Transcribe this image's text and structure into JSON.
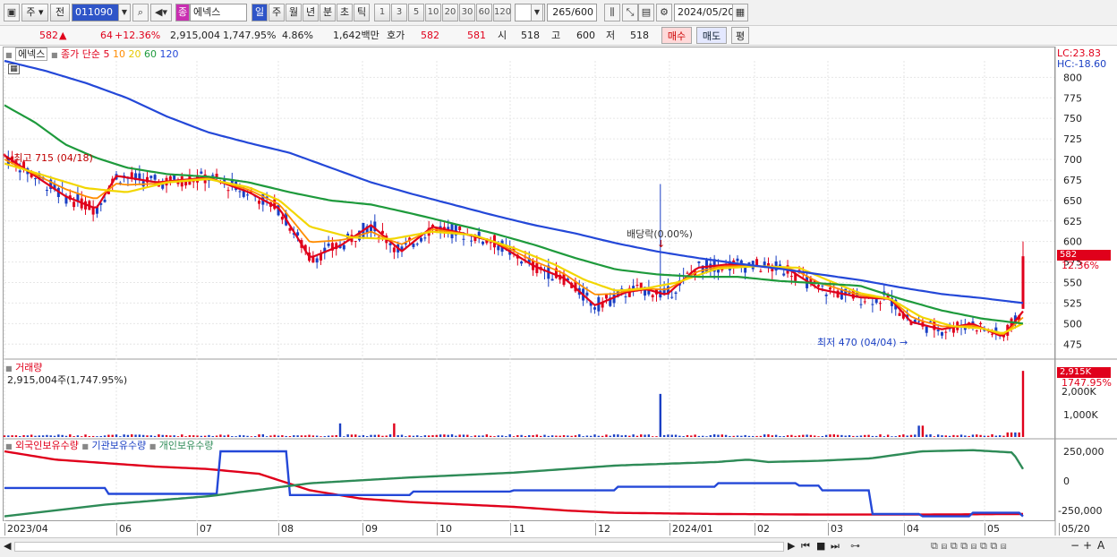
{
  "toolbar": {
    "type_label": "주",
    "prev_label": "전",
    "code_value": "011090",
    "company_value": "에넥스",
    "periods": [
      "일",
      "주",
      "월",
      "년",
      "분",
      "초",
      "틱"
    ],
    "minutes": [
      "1",
      "3",
      "5",
      "10",
      "20",
      "30",
      "60",
      "120"
    ],
    "count_value": "265",
    "count_total": "/600",
    "date_value": "2024/05/20"
  },
  "quote": {
    "price": "582",
    "change": "64",
    "change_pct": "+12.36%",
    "volume": "2,915,004",
    "volume_pct": "1,747.95%",
    "turnover": "4.86%",
    "amount": "1,642백만",
    "ask_label": "호가",
    "ask1": "582",
    "ask2": "581",
    "open_label": "시",
    "open": "518",
    "high_label": "고",
    "high": "600",
    "low_label": "저",
    "low": "518",
    "buy_label": "매수",
    "sell_label": "매도",
    "eval_label": "평"
  },
  "price_panel": {
    "legend_name": "에넥스",
    "legend_ma": "종가 단순",
    "ma_periods": [
      "5",
      "10",
      "20",
      "60",
      "120"
    ],
    "lc": "LC:23.83",
    "hc": "HC:-18.60",
    "high_note": "최고 715 (04/18)",
    "low_note": "최저 470 (04/04)",
    "dividend_note": "배당락(0.00%)",
    "current_price_tag": "582",
    "current_pct_tag": "12.36%",
    "y_ticks": [
      "800",
      "775",
      "750",
      "725",
      "700",
      "675",
      "650",
      "625",
      "600",
      "575",
      "550",
      "525",
      "500",
      "475"
    ]
  },
  "volume_panel": {
    "title": "거래량",
    "value_text": "2,915,004주(1,747.95%)",
    "current_tag": "2,915K",
    "current_pct": "1747.95%",
    "y_ticks": [
      "2,000K",
      "1,000K"
    ]
  },
  "holding_panel": {
    "legend": [
      "외국인보유수량",
      "기관보유수량",
      "개인보유수량"
    ],
    "y_ticks": [
      "250,000",
      "0",
      "-250,000"
    ]
  },
  "x_axis": [
    "2023/04",
    "06",
    "07",
    "08",
    "09",
    "10",
    "11",
    "12",
    "2024/01",
    "02",
    "03",
    "04",
    "05",
    "05/20"
  ],
  "colors": {
    "up": "#e0001b",
    "down": "#1a3fc4",
    "ma5": "#e0001b",
    "ma10": "#ff8c00",
    "ma20": "#f2d600",
    "ma60": "#1e9a3c",
    "ma120": "#2448d8",
    "foreign": "#e0001b",
    "inst": "#2448d8",
    "indiv": "#2e8b57"
  },
  "chart_data": {
    "type": "candlestick",
    "title": "에넥스",
    "period": "daily",
    "last": {
      "date": "2024/05/20",
      "open": 518,
      "high": 600,
      "low": 518,
      "close": 582,
      "volume": 2915004
    },
    "price_range": [
      460,
      820
    ],
    "highest": {
      "value": 715,
      "date": "04/18"
    },
    "lowest": {
      "value": 470,
      "date": "04/04"
    },
    "ma_series": [
      {
        "name": "5",
        "points": [
          [
            0,
            705
          ],
          [
            0.03,
            680
          ],
          [
            0.06,
            655
          ],
          [
            0.09,
            640
          ],
          [
            0.11,
            680
          ],
          [
            0.15,
            672
          ],
          [
            0.2,
            678
          ],
          [
            0.24,
            660
          ],
          [
            0.27,
            640
          ],
          [
            0.3,
            580
          ],
          [
            0.33,
            595
          ],
          [
            0.36,
            620
          ],
          [
            0.39,
            588
          ],
          [
            0.42,
            618
          ],
          [
            0.45,
            610
          ],
          [
            0.48,
            600
          ],
          [
            0.52,
            570
          ],
          [
            0.55,
            555
          ],
          [
            0.58,
            522
          ],
          [
            0.61,
            538
          ],
          [
            0.63,
            542
          ],
          [
            0.65,
            535
          ],
          [
            0.68,
            568
          ],
          [
            0.71,
            572
          ],
          [
            0.74,
            570
          ],
          [
            0.77,
            566
          ],
          [
            0.8,
            542
          ],
          [
            0.84,
            532
          ],
          [
            0.87,
            530
          ],
          [
            0.89,
            502
          ],
          [
            0.92,
            493
          ],
          [
            0.95,
            500
          ],
          [
            0.98,
            484
          ],
          [
            1,
            515
          ]
        ]
      },
      {
        "name": "20",
        "points": [
          [
            0,
            695
          ],
          [
            0.04,
            680
          ],
          [
            0.08,
            665
          ],
          [
            0.12,
            660
          ],
          [
            0.16,
            672
          ],
          [
            0.2,
            676
          ],
          [
            0.24,
            666
          ],
          [
            0.27,
            650
          ],
          [
            0.3,
            618
          ],
          [
            0.34,
            605
          ],
          [
            0.38,
            603
          ],
          [
            0.42,
            612
          ],
          [
            0.46,
            608
          ],
          [
            0.5,
            592
          ],
          [
            0.54,
            572
          ],
          [
            0.57,
            553
          ],
          [
            0.6,
            540
          ],
          [
            0.63,
            543
          ],
          [
            0.66,
            550
          ],
          [
            0.7,
            567
          ],
          [
            0.74,
            570
          ],
          [
            0.78,
            568
          ],
          [
            0.81,
            552
          ],
          [
            0.84,
            537
          ],
          [
            0.87,
            530
          ],
          [
            0.9,
            508
          ],
          [
            0.93,
            497
          ],
          [
            0.96,
            494
          ],
          [
            0.98,
            488
          ],
          [
            1,
            500
          ]
        ]
      },
      {
        "name": "60",
        "points": [
          [
            0,
            766
          ],
          [
            0.03,
            745
          ],
          [
            0.06,
            718
          ],
          [
            0.09,
            702
          ],
          [
            0.12,
            690
          ],
          [
            0.16,
            682
          ],
          [
            0.2,
            679
          ],
          [
            0.24,
            672
          ],
          [
            0.28,
            660
          ],
          [
            0.32,
            650
          ],
          [
            0.36,
            645
          ],
          [
            0.4,
            634
          ],
          [
            0.44,
            622
          ],
          [
            0.48,
            610
          ],
          [
            0.52,
            596
          ],
          [
            0.56,
            580
          ],
          [
            0.6,
            566
          ],
          [
            0.64,
            560
          ],
          [
            0.68,
            557
          ],
          [
            0.72,
            557
          ],
          [
            0.76,
            552
          ],
          [
            0.8,
            549
          ],
          [
            0.84,
            546
          ],
          [
            0.88,
            530
          ],
          [
            0.92,
            516
          ],
          [
            0.96,
            506
          ],
          [
            1,
            500
          ]
        ]
      },
      {
        "name": "120",
        "points": [
          [
            0,
            820
          ],
          [
            0.04,
            808
          ],
          [
            0.08,
            793
          ],
          [
            0.12,
            775
          ],
          [
            0.16,
            752
          ],
          [
            0.2,
            733
          ],
          [
            0.24,
            720
          ],
          [
            0.28,
            708
          ],
          [
            0.32,
            690
          ],
          [
            0.36,
            672
          ],
          [
            0.4,
            658
          ],
          [
            0.44,
            645
          ],
          [
            0.48,
            632
          ],
          [
            0.52,
            620
          ],
          [
            0.56,
            610
          ],
          [
            0.6,
            598
          ],
          [
            0.64,
            588
          ],
          [
            0.68,
            580
          ],
          [
            0.72,
            573
          ],
          [
            0.76,
            567
          ],
          [
            0.8,
            560
          ],
          [
            0.84,
            553
          ],
          [
            0.88,
            544
          ],
          [
            0.92,
            536
          ],
          [
            0.96,
            531
          ],
          [
            1,
            525
          ]
        ]
      }
    ],
    "holdings": [
      {
        "name": "외국인보유수량",
        "points": [
          [
            0,
            250000
          ],
          [
            0.05,
            180000
          ],
          [
            0.1,
            150000
          ],
          [
            0.15,
            120000
          ],
          [
            0.2,
            100000
          ],
          [
            0.25,
            60000
          ],
          [
            0.3,
            -80000
          ],
          [
            0.35,
            -150000
          ],
          [
            0.4,
            -180000
          ],
          [
            0.45,
            -200000
          ],
          [
            0.5,
            -220000
          ],
          [
            0.55,
            -250000
          ],
          [
            0.6,
            -270000
          ],
          [
            0.7,
            -280000
          ],
          [
            0.8,
            -285000
          ],
          [
            0.9,
            -285000
          ],
          [
            1,
            -280000
          ]
        ]
      },
      {
        "name": "기관보유수량",
        "points": [
          [
            0,
            -60000
          ],
          [
            0.1,
            -110000
          ],
          [
            0.2,
            -110000
          ],
          [
            0.21,
            250000
          ],
          [
            0.27,
            250000
          ],
          [
            0.28,
            -120000
          ],
          [
            0.4,
            -90000
          ],
          [
            0.5,
            -80000
          ],
          [
            0.6,
            -50000
          ],
          [
            0.7,
            -20000
          ],
          [
            0.78,
            -40000
          ],
          [
            0.8,
            -80000
          ],
          [
            0.85,
            -280000
          ],
          [
            0.9,
            -300000
          ],
          [
            0.95,
            -270000
          ],
          [
            1,
            -300000
          ]
        ]
      },
      {
        "name": "개인보유수량",
        "points": [
          [
            0,
            -300000
          ],
          [
            0.1,
            -200000
          ],
          [
            0.2,
            -130000
          ],
          [
            0.3,
            -20000
          ],
          [
            0.4,
            30000
          ],
          [
            0.5,
            70000
          ],
          [
            0.6,
            130000
          ],
          [
            0.7,
            160000
          ],
          [
            0.73,
            180000
          ],
          [
            0.75,
            160000
          ],
          [
            0.8,
            170000
          ],
          [
            0.85,
            190000
          ],
          [
            0.9,
            250000
          ],
          [
            0.95,
            260000
          ],
          [
            0.99,
            240000
          ],
          [
            1,
            100000
          ]
        ]
      }
    ],
    "xlabel": "",
    "ylabel": ""
  }
}
